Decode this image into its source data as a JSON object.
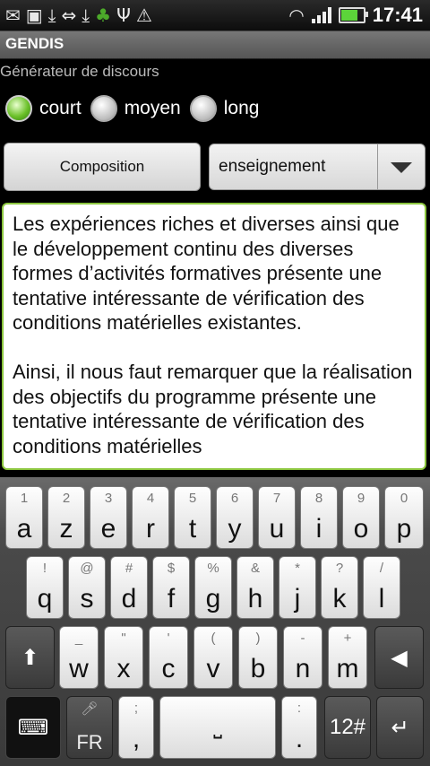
{
  "status": {
    "time": "17:41"
  },
  "app": {
    "title": "GENDIS",
    "subtitle": "Générateur de discours"
  },
  "length_options": [
    {
      "label": "court",
      "selected": true
    },
    {
      "label": "moyen",
      "selected": false
    },
    {
      "label": "long",
      "selected": false
    }
  ],
  "compose_button": "Composition",
  "topic_spinner": {
    "value": "enseignement"
  },
  "speech_text": "Les expériences riches et diverses ainsi que le développement continu des diverses formes d’activités formatives présente une tentative intéressante de vérification des conditions matérielles existantes.\n\nAinsi, il nous faut remarquer que la réalisation des objectifs du programme présente une tentative intéressante de vérification des conditions matérielles",
  "keyboard": {
    "row1": [
      {
        "main": "a",
        "sym": "1"
      },
      {
        "main": "z",
        "sym": "2"
      },
      {
        "main": "e",
        "sym": "3"
      },
      {
        "main": "r",
        "sym": "4"
      },
      {
        "main": "t",
        "sym": "5"
      },
      {
        "main": "y",
        "sym": "6"
      },
      {
        "main": "u",
        "sym": "7"
      },
      {
        "main": "i",
        "sym": "8"
      },
      {
        "main": "o",
        "sym": "9"
      },
      {
        "main": "p",
        "sym": "0"
      }
    ],
    "row2": [
      {
        "main": "q",
        "sym": "!"
      },
      {
        "main": "s",
        "sym": "@"
      },
      {
        "main": "d",
        "sym": "#"
      },
      {
        "main": "f",
        "sym": "$"
      },
      {
        "main": "g",
        "sym": "%"
      },
      {
        "main": "h",
        "sym": "&"
      },
      {
        "main": "j",
        "sym": "*"
      },
      {
        "main": "k",
        "sym": "?"
      },
      {
        "main": "l",
        "sym": "/"
      }
    ],
    "row3": [
      {
        "main": "w",
        "sym": "_"
      },
      {
        "main": "x",
        "sym": "\""
      },
      {
        "main": "c",
        "sym": "'"
      },
      {
        "main": "v",
        "sym": "("
      },
      {
        "main": "b",
        "sym": ")"
      },
      {
        "main": "n",
        "sym": "-"
      },
      {
        "main": "m",
        "sym": "+"
      }
    ],
    "lang_label": "FR",
    "comma_key": {
      "main": ",",
      "sym": ";"
    },
    "period_key": {
      "main": ".",
      "sym": ":"
    },
    "numbers_label": "12#"
  }
}
